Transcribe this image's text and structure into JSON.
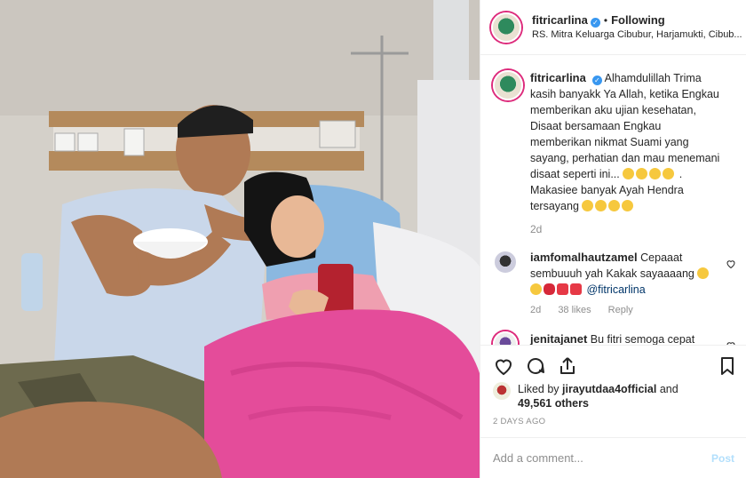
{
  "post": {
    "username": "fitricarlina",
    "separator": "•",
    "follow_status": "Following",
    "location": "RS. Mitra Keluarga Cibubur, Harjamukti, Cibub..."
  },
  "caption": {
    "username": "fitricarlina",
    "text": "Alhamdulillah Trima kasih banyakk Ya Allah, ketika Engkau memberikan aku ujian kesehatan, Disaat bersamaan Engkau memberikan nikmat Suami yang sayang, perhatian dan mau menemani disaat seperti ini...",
    "text_after_emoji": ". Makasiee banyak Ayah Hendra tersayang",
    "age": "2d"
  },
  "comments": [
    {
      "username": "iamfomalhautzamel",
      "text": "Cepaaat sembuuuh yah Kakak sayaaaang",
      "mention": "@fitricarlina",
      "age": "2d",
      "likes": "38 likes",
      "reply": "Reply"
    },
    {
      "username": "jenitajanet",
      "text": "Bu fitri semoga cepat sembuh semangattt"
    }
  ],
  "likes": {
    "prefix": "Liked by",
    "user": "jirayutdaa4official",
    "conj": "and",
    "others": "49,561 others"
  },
  "post_date": "2 DAYS AGO",
  "add_comment": {
    "placeholder": "Add a comment...",
    "post_label": "Post"
  },
  "icons": {
    "like": "heart-icon",
    "comment": "comment-bubble-icon",
    "share": "share-icon",
    "save": "bookmark-icon"
  },
  "colors": {
    "verified": "#3897f0",
    "link": "#003569",
    "muted": "#8e8e8e",
    "post_disabled": "#b2dffc",
    "story_ring": "#dd2a7b"
  }
}
